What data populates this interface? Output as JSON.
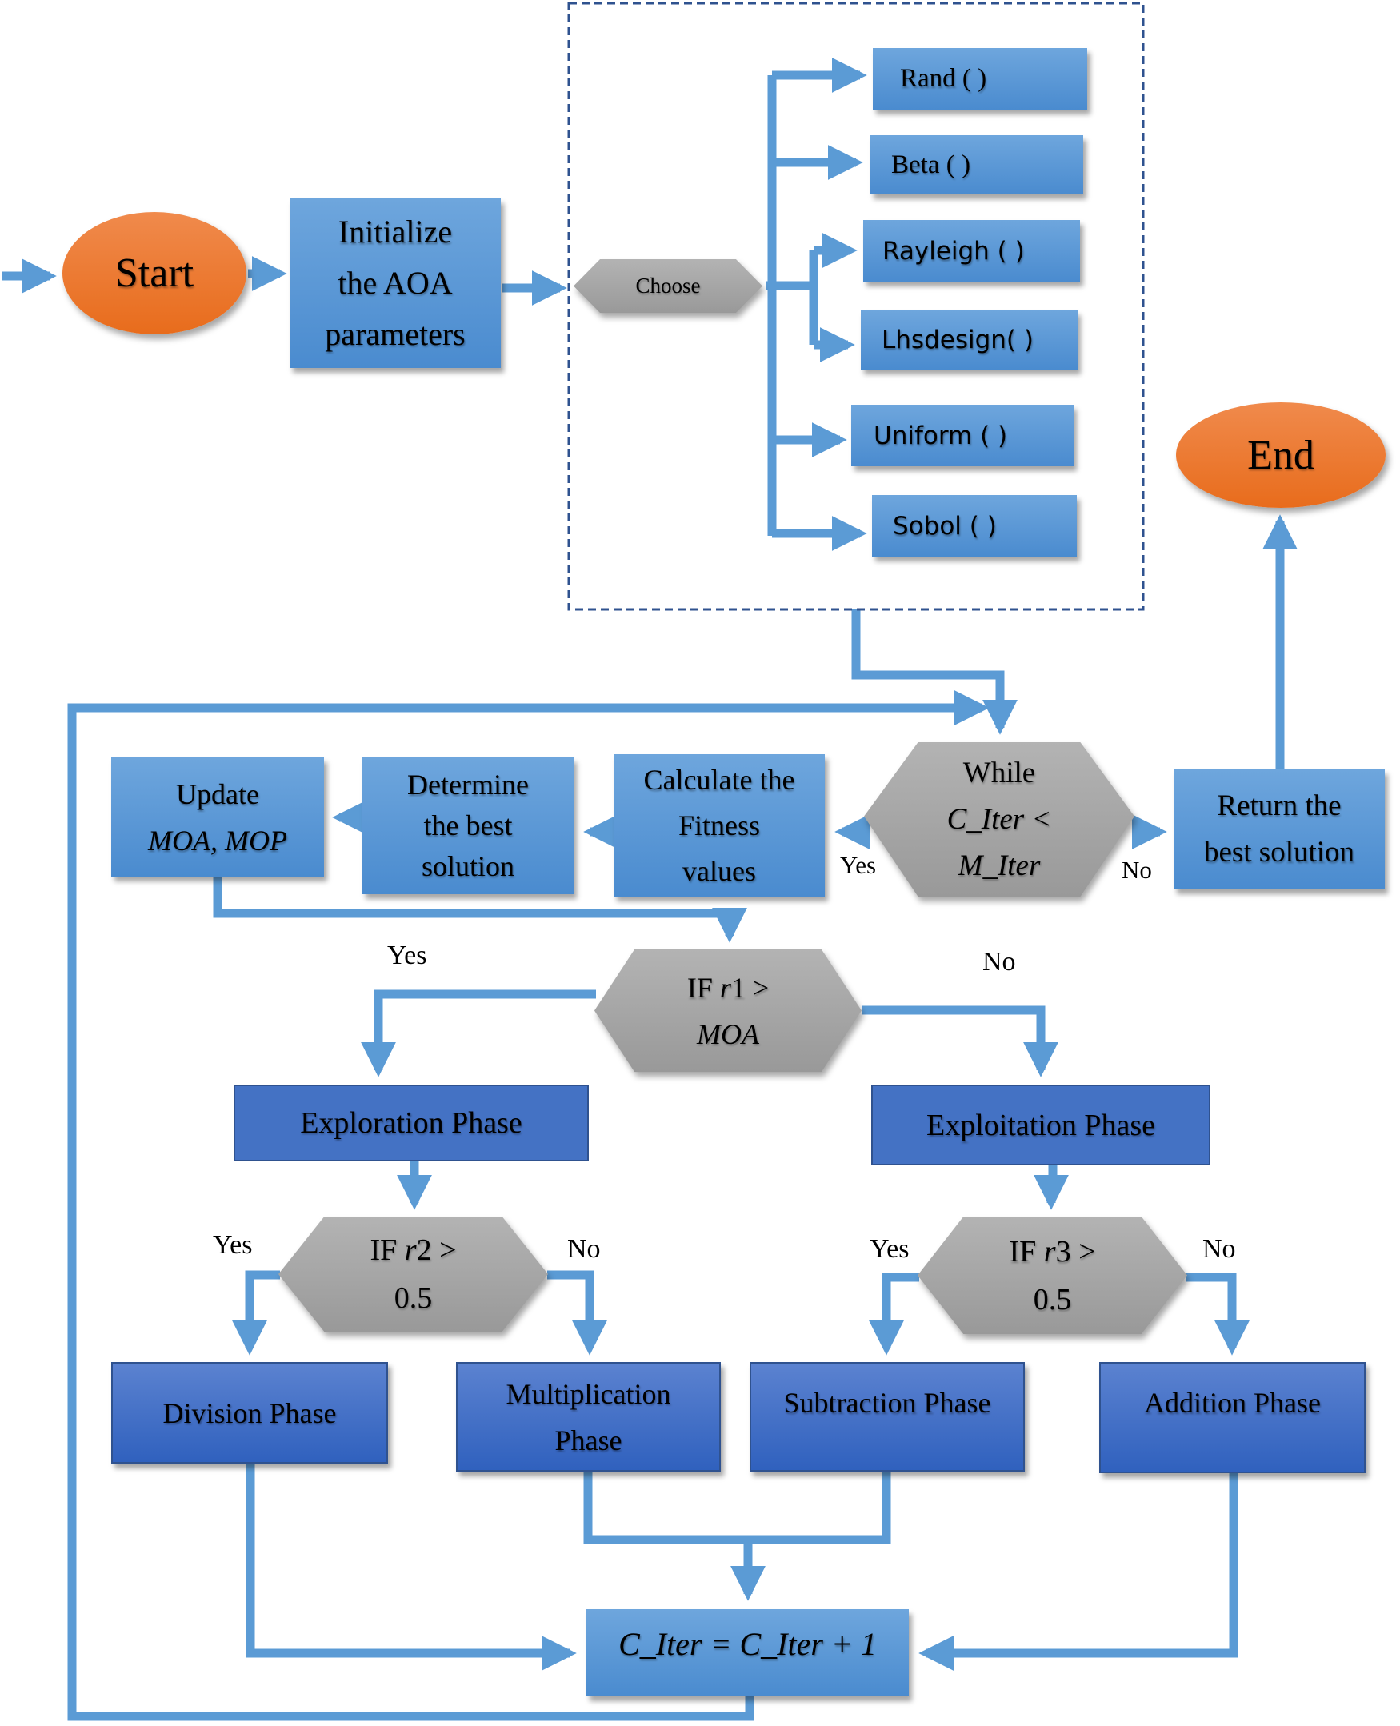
{
  "diagram": {
    "colors": {
      "arrow": "#5b9bd5",
      "dashed_border": "#2f528f",
      "terminal": "#ed7d31",
      "process": "#5b9bd5",
      "phase": "#4472c4",
      "decision": "#a5a5a5"
    },
    "start": {
      "label": "Start"
    },
    "end": {
      "label": "End"
    },
    "initialize": {
      "lines": [
        "Initialize",
        "the AOA",
        "parameters"
      ]
    },
    "choose": {
      "label": "Choose"
    },
    "distributions": [
      "Rand ( )",
      "Beta ( )",
      "Rayleigh ( )",
      "Lhsdesign( )",
      "Uniform ( )",
      "Sobol ( )"
    ],
    "while_cond": {
      "lines": [
        "While",
        "C_Iter <",
        "M_Iter"
      ]
    },
    "return_best": {
      "lines": [
        "Return the",
        "best solution"
      ]
    },
    "calculate": {
      "lines": [
        "Calculate the",
        "Fitness",
        "values"
      ]
    },
    "determine": {
      "lines": [
        "Determine",
        "the best",
        "solution"
      ]
    },
    "update": {
      "line1": "Update",
      "line2": "MOA, MOP"
    },
    "if_r1": {
      "prefix": "IF ",
      "var": "r",
      "suffix": "1 >",
      "line2": "MOA"
    },
    "if_r2": {
      "prefix": "IF ",
      "var": "r",
      "suffix": "2 >",
      "line2": "0.5"
    },
    "if_r3": {
      "prefix": "IF ",
      "var": "r",
      "suffix": "3 >",
      "line2": "0.5"
    },
    "exploration": {
      "label": "Exploration Phase"
    },
    "exploitation": {
      "label": "Exploitation Phase"
    },
    "division": {
      "label": "Division Phase"
    },
    "multiplication": {
      "lines": [
        "Multiplication",
        "Phase"
      ]
    },
    "subtraction": {
      "label": "Subtraction Phase"
    },
    "addition": {
      "label": "Addition Phase"
    },
    "increment": {
      "label": "C_Iter = C_Iter + 1"
    },
    "branch_labels": {
      "while_yes": "Yes",
      "while_no": "No",
      "r1_yes": "Yes",
      "r1_no": "No",
      "r2_yes": "Yes",
      "r2_no": "No",
      "r3_yes": "Yes",
      "r3_no": "No"
    }
  }
}
